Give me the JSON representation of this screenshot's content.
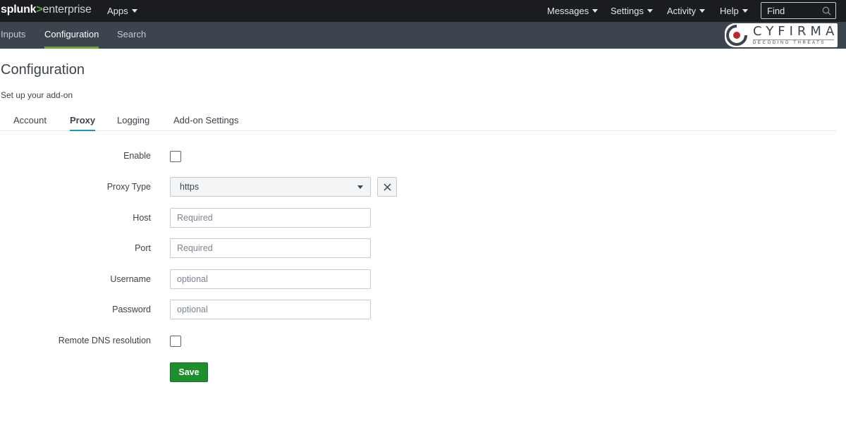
{
  "topbar": {
    "logo": {
      "part1": "splunk",
      "part2": ">",
      "part3": "enterprise"
    },
    "apps_label": "Apps",
    "messages_label": "Messages",
    "settings_label": "Settings",
    "activity_label": "Activity",
    "help_label": "Help",
    "find_placeholder": "Find"
  },
  "appbar": {
    "nav": [
      "Inputs",
      "Configuration",
      "Search"
    ],
    "active": "Configuration",
    "brand_name": "CYFIRMA",
    "brand_tagline": "DECODING THREATS"
  },
  "page": {
    "title": "Configuration",
    "subtitle": "Set up your add-on",
    "tabs": [
      "Account",
      "Proxy",
      "Logging",
      "Add-on Settings"
    ],
    "active_tab": "Proxy"
  },
  "form": {
    "enable_label": "Enable",
    "enable_checked": false,
    "proxy_type_label": "Proxy Type",
    "proxy_type_value": "https",
    "host_label": "Host",
    "host_placeholder": "Required",
    "port_label": "Port",
    "port_placeholder": "Required",
    "username_label": "Username",
    "username_placeholder": "optional",
    "password_label": "Password",
    "password_placeholder": "optional",
    "remote_dns_label": "Remote DNS resolution",
    "remote_dns_checked": false,
    "save_label": "Save"
  },
  "colors": {
    "topbar_bg": "#1a1c20",
    "appbar_bg": "#3c444d",
    "accent_green": "#65a637",
    "active_tab_underline": "#1e93c6",
    "save_button": "#1f8f2e"
  }
}
